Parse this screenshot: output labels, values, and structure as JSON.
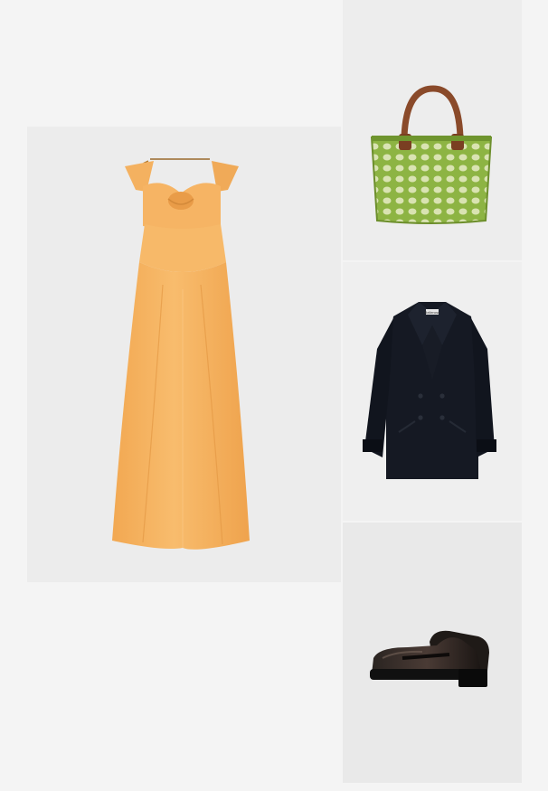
{
  "collage": {
    "items": [
      {
        "id": "dress",
        "icon": "maxi-dress",
        "color": "#f6b25f"
      },
      {
        "id": "bag",
        "icon": "woven-tote-bag",
        "color": "#7fa43a"
      },
      {
        "id": "coat",
        "icon": "pea-coat",
        "color": "#151923"
      },
      {
        "id": "shoe",
        "icon": "loafer-shoe",
        "color": "#1c1816"
      }
    ]
  },
  "coat": {
    "label_text": "Bellerose"
  }
}
